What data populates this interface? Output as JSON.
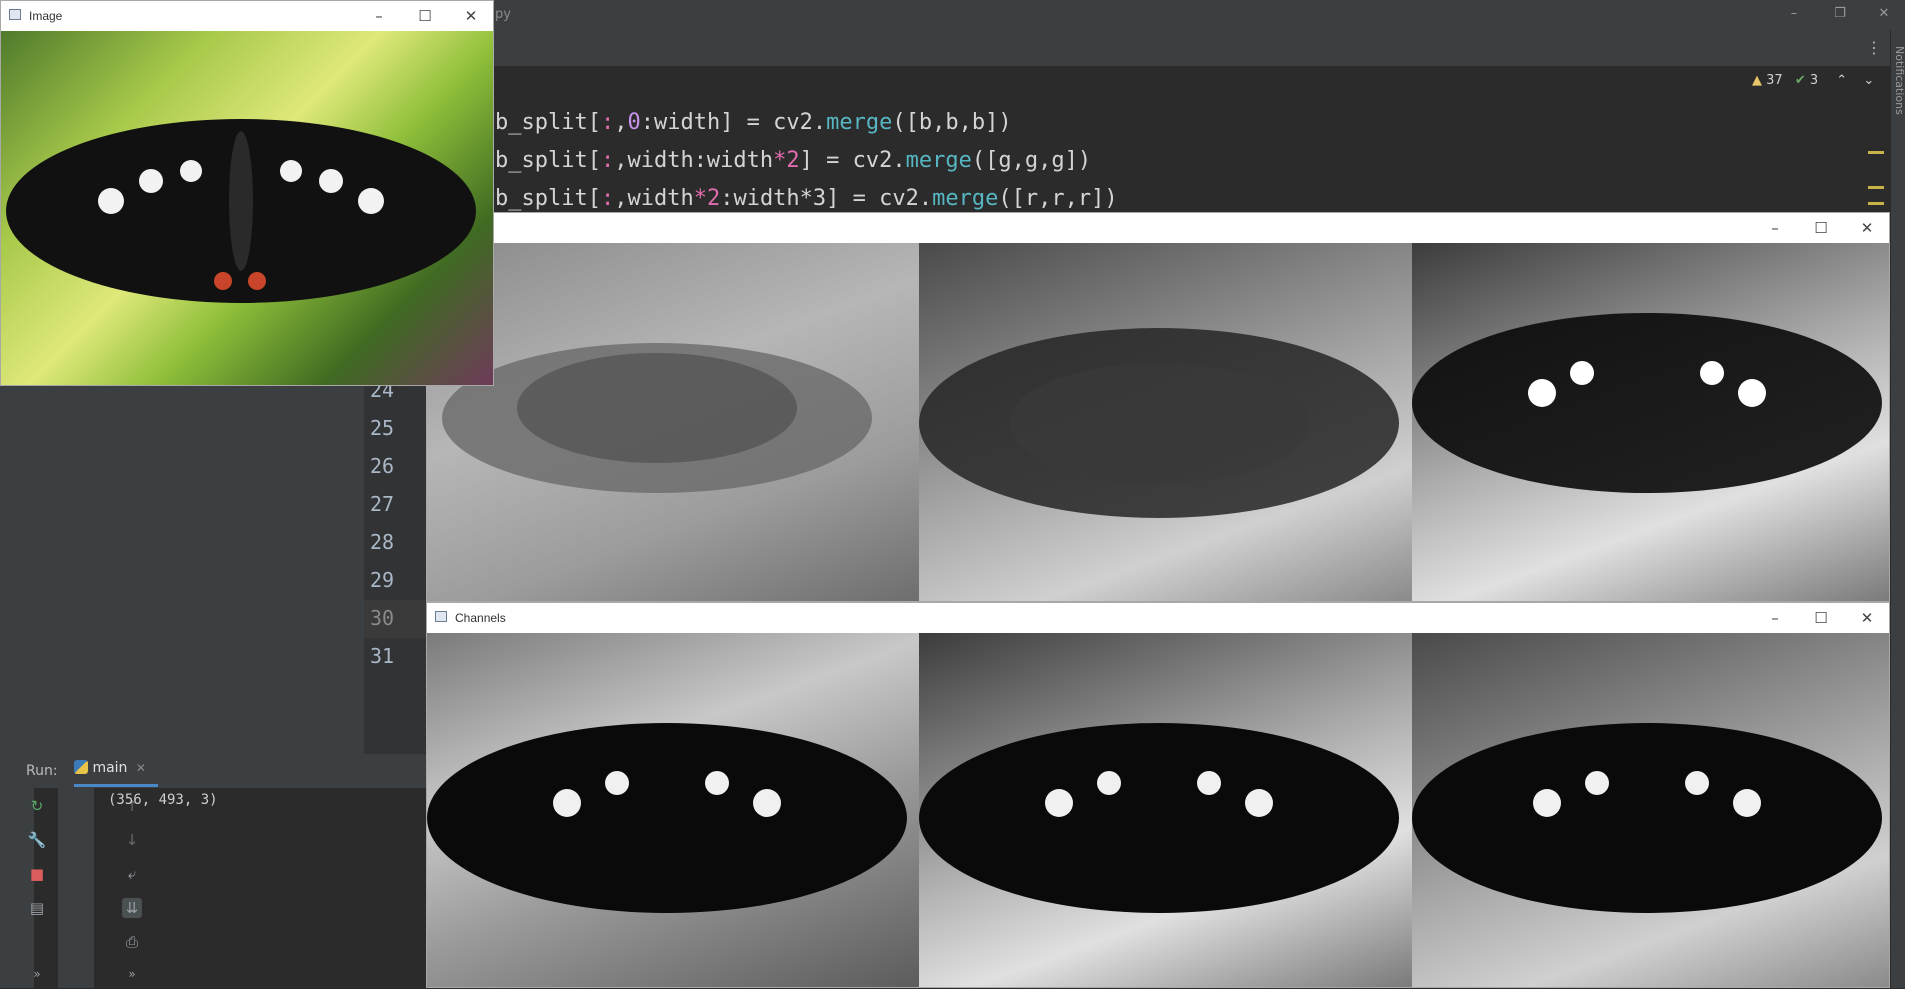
{
  "ide": {
    "title_fragment": "py",
    "code_lines": [
      {
        "text_a": "b_split[",
        "a": ":",
        "b": ",",
        "c": "0",
        "d": ":width] = cv2.",
        "fn": "merge",
        "e": "([b,b,b])"
      },
      {
        "text_a": "b_split[",
        "a": ":",
        "b": ",width:width",
        "c": "*2",
        "d": "] = cv2.",
        "fn": "merge",
        "e": "([g,g,g])"
      },
      {
        "text_a": "b_split[",
        "a": ":",
        "b": ",width",
        "c": "*2",
        "d": ":width*3] = cv2.",
        "fn": "merge",
        "e": "([r,r,r])"
      }
    ],
    "inspections": {
      "warnings": "37",
      "weak_warnings": "3"
    },
    "line_numbers": [
      "24",
      "25",
      "26",
      "27",
      "28",
      "29",
      "30",
      "31"
    ],
    "notifications_label": "Notifications"
  },
  "run": {
    "label": "Run:",
    "tab": "main",
    "output": "(356, 493, 3)"
  },
  "windows": {
    "image": {
      "title": "Image"
    },
    "middle": {
      "title": ""
    },
    "channels": {
      "title": "Channels"
    }
  },
  "colors": {
    "ide_bg": "#2b2b2b",
    "panel_bg": "#3c3f41",
    "accent": "#4a88c7"
  }
}
